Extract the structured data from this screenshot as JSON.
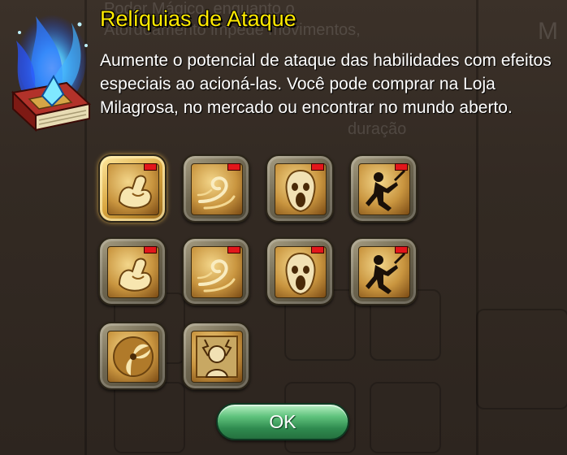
{
  "dialog": {
    "title": "Relíquias de Ataque",
    "description": "Aumente o potencial de ataque das habilidades com efeitos especiais ao acioná-las. Você pode comprar na Loja Milagrosa, no mercado ou encontrar no mundo aberto.",
    "icon": "blue-flame-spellbook-icon",
    "ok_label": "OK"
  },
  "relics": [
    {
      "icon": "flexed-arm-icon",
      "selected": true,
      "red_tag": true
    },
    {
      "icon": "wind-swirl-icon",
      "selected": false,
      "red_tag": true
    },
    {
      "icon": "screaming-ghost-icon",
      "selected": false,
      "red_tag": true
    },
    {
      "icon": "kneeling-swordsman-icon",
      "selected": false,
      "red_tag": true
    },
    {
      "icon": "flexed-arm-icon",
      "selected": false,
      "red_tag": true
    },
    {
      "icon": "wind-swirl-icon",
      "selected": false,
      "red_tag": true
    },
    {
      "icon": "screaming-ghost-icon",
      "selected": false,
      "red_tag": true
    },
    {
      "icon": "kneeling-swordsman-icon",
      "selected": false,
      "red_tag": true
    },
    {
      "icon": "spinning-triskele-icon",
      "selected": false,
      "red_tag": false
    },
    {
      "icon": "electrified-head-icon",
      "selected": false,
      "red_tag": false
    }
  ],
  "background_text": {
    "line1": "Poder Mágico, enquanto o",
    "line2": "Atordoamento impede movimentos,",
    "line3": "duração",
    "side": "M"
  },
  "colors": {
    "title": "#ffea00",
    "text": "#ffffff",
    "button": "#2f8b4f",
    "red_tag": "#e3161b"
  }
}
